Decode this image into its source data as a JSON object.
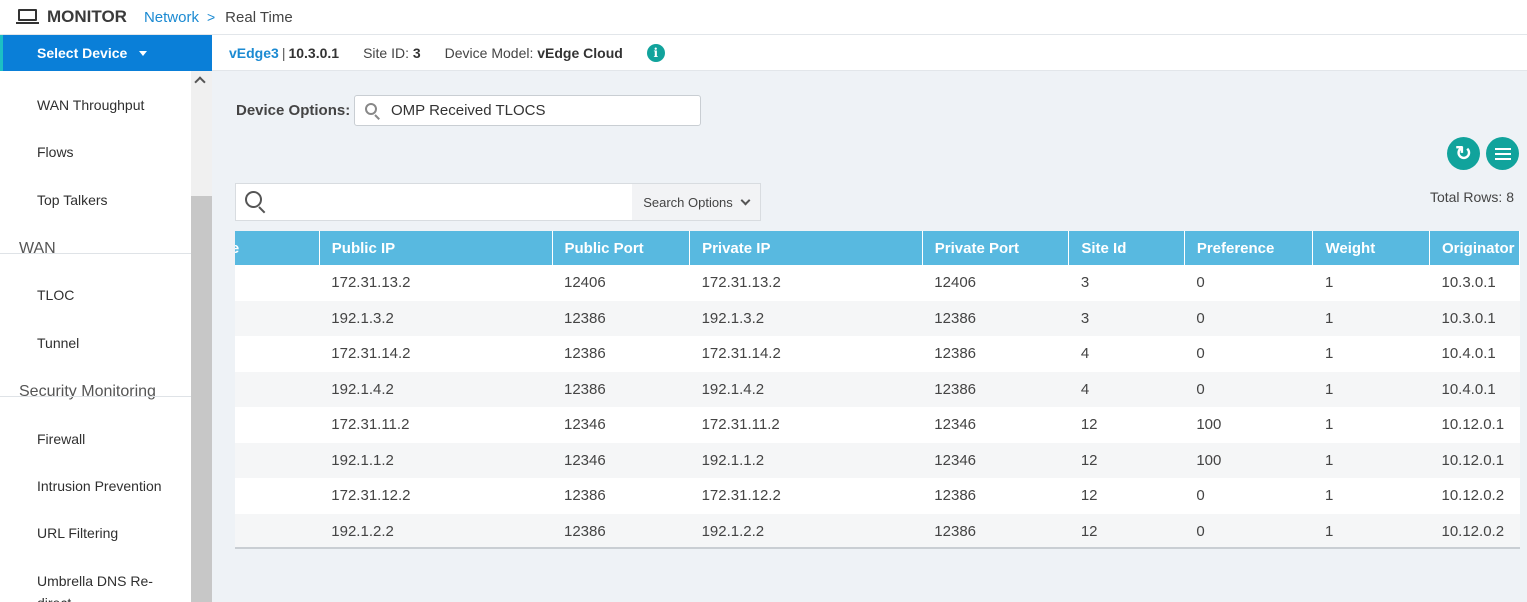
{
  "header": {
    "title": "MONITOR",
    "breadcrumb_link": "Network",
    "breadcrumb_sep": ">",
    "breadcrumb_current": "Real Time"
  },
  "sidebar": {
    "select_device": "Select Device",
    "items": [
      {
        "label": "WAN Throughput",
        "type": "item"
      },
      {
        "label": "Flows",
        "type": "item"
      },
      {
        "label": "Top Talkers",
        "type": "item"
      },
      {
        "label": "WAN",
        "type": "section"
      },
      {
        "label": "TLOC",
        "type": "item"
      },
      {
        "label": "Tunnel",
        "type": "item"
      },
      {
        "label": "Security Monitoring",
        "type": "section"
      },
      {
        "label": "Firewall",
        "type": "item"
      },
      {
        "label": "Intrusion Prevention",
        "type": "item"
      },
      {
        "label": "URL Filtering",
        "type": "item"
      },
      {
        "label": "Umbrella DNS Re-",
        "type": "item"
      },
      {
        "label": "direct",
        "type": "item"
      }
    ]
  },
  "device": {
    "name": "vEdge3",
    "separator": "|",
    "ip": "10.3.0.1",
    "site_label": "Site ID:",
    "site_value": "3",
    "model_label": "Device Model:",
    "model_value": "vEdge Cloud",
    "info_glyph": "i"
  },
  "device_options": {
    "label": "Device Options:",
    "value": "OMP Received TLOCS"
  },
  "actions": {
    "refresh_icon": "refresh-icon",
    "menu_icon": "menu-icon"
  },
  "search": {
    "placeholder": "",
    "options_label": "Search Options"
  },
  "table": {
    "total_rows_label": "Total Rows: 8",
    "columns": [
      "Color Type",
      "Public IP",
      "Public Port",
      "Private IP",
      "Private Port",
      "Site Id",
      "Preference",
      "Weight",
      "Originator"
    ],
    "rows": [
      [
        "",
        "172.31.13.2",
        "12406",
        "172.31.13.2",
        "12406",
        "3",
        "0",
        "1",
        "10.3.0.1"
      ],
      [
        "",
        "192.1.3.2",
        "12386",
        "192.1.3.2",
        "12386",
        "3",
        "0",
        "1",
        "10.3.0.1"
      ],
      [
        "",
        "172.31.14.2",
        "12386",
        "172.31.14.2",
        "12386",
        "4",
        "0",
        "1",
        "10.4.0.1"
      ],
      [
        "",
        "192.1.4.2",
        "12386",
        "192.1.4.2",
        "12386",
        "4",
        "0",
        "1",
        "10.4.0.1"
      ],
      [
        "",
        "172.31.11.2",
        "12346",
        "172.31.11.2",
        "12346",
        "12",
        "100",
        "1",
        "10.12.0.1"
      ],
      [
        "",
        "192.1.1.2",
        "12346",
        "192.1.1.2",
        "12346",
        "12",
        "100",
        "1",
        "10.12.0.1"
      ],
      [
        "",
        "172.31.12.2",
        "12386",
        "172.31.12.2",
        "12386",
        "12",
        "0",
        "1",
        "10.12.0.2"
      ],
      [
        "",
        "192.1.2.2",
        "12386",
        "192.1.2.2",
        "12386",
        "12",
        "0",
        "1",
        "10.12.0.2"
      ]
    ]
  }
}
